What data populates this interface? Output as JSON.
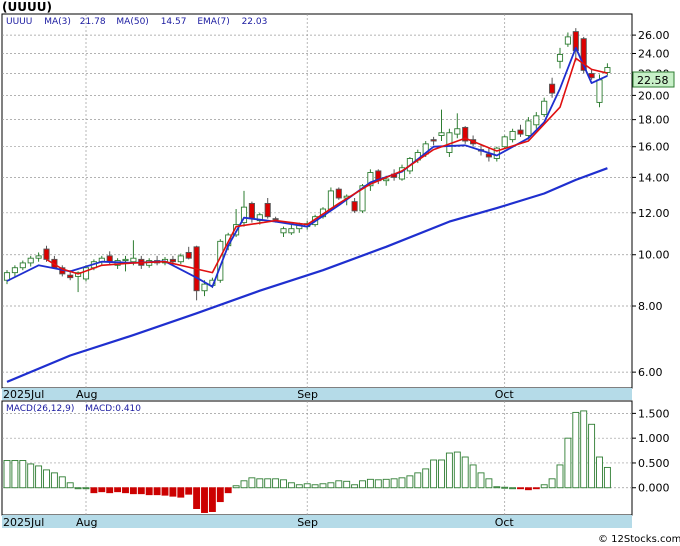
{
  "ticker": "(UUUU)",
  "price_legend": {
    "symbol": "UUUU",
    "ma3_label": "MA(3)",
    "ma3_value": "21.78",
    "ma50_label": "MA(50)",
    "ma50_value": "14.57",
    "ema7_label": "EMA(7)",
    "ema7_value": "22.03"
  },
  "macd_legend": {
    "params_label": "MACD(26,12,9)",
    "value_label": "MACD:0.410"
  },
  "last_price_label": "22.58",
  "watermark": "© 12Stocks.com",
  "colors": {
    "up_candle": "#2e7d32",
    "down_candle": "#dd0000",
    "ma_line": "#1f2fcf",
    "ema_line": "#e01010",
    "macd_positive": "#2e7d32",
    "macd_negative": "#cc0000",
    "date_strip": "#b5dbe8",
    "grid": "#999999",
    "last_price_badge": "#c8f0c8"
  },
  "chart_data": [
    {
      "type": "candlestick",
      "y_scale": "log",
      "ylim": [
        5.6,
        28.5
      ],
      "grid": true,
      "y_ticks": [
        "6.00",
        "8.00",
        "10.00",
        "12.00",
        "14.00",
        "16.00",
        "18.00",
        "20.00",
        "22.00",
        "24.00",
        "26.00"
      ],
      "y_tick_values": [
        6,
        8,
        10,
        12,
        14,
        16,
        18,
        20,
        22,
        24,
        26
      ],
      "x_labels": [
        {
          "label": "2025Jul",
          "index": 0
        },
        {
          "label": "Aug",
          "index": 10
        },
        {
          "label": "Sep",
          "index": 38
        },
        {
          "label": "Oct",
          "index": 63
        }
      ],
      "candles": [
        [
          8.95,
          9.35,
          8.8,
          9.25
        ],
        [
          9.25,
          9.55,
          9.1,
          9.45
        ],
        [
          9.45,
          9.75,
          9.35,
          9.65
        ],
        [
          9.65,
          9.95,
          9.5,
          9.85
        ],
        [
          9.85,
          10.1,
          9.7,
          9.95
        ],
        [
          10.25,
          10.4,
          9.7,
          9.8
        ],
        [
          9.8,
          9.95,
          9.4,
          9.45
        ],
        [
          9.45,
          9.55,
          9.1,
          9.2
        ],
        [
          9.15,
          9.35,
          8.95,
          9.05
        ],
        [
          9.1,
          9.3,
          8.5,
          9.25
        ],
        [
          9.0,
          9.55,
          8.9,
          9.45
        ],
        [
          9.45,
          9.8,
          9.35,
          9.7
        ],
        [
          9.7,
          9.95,
          9.55,
          9.85
        ],
        [
          9.95,
          10.15,
          9.6,
          9.7
        ],
        [
          9.55,
          9.85,
          9.4,
          9.75
        ],
        [
          9.75,
          9.95,
          9.3,
          9.8
        ],
        [
          9.7,
          10.65,
          9.55,
          9.85
        ],
        [
          9.8,
          9.95,
          9.4,
          9.55
        ],
        [
          9.55,
          9.85,
          9.45,
          9.75
        ],
        [
          9.75,
          9.95,
          9.55,
          9.65
        ],
        [
          9.65,
          9.9,
          9.55,
          9.8
        ],
        [
          9.8,
          9.95,
          9.55,
          9.7
        ],
        [
          9.7,
          10.05,
          9.6,
          9.95
        ],
        [
          10.1,
          10.35,
          9.8,
          9.85
        ],
        [
          10.35,
          10.4,
          8.2,
          8.55
        ],
        [
          8.55,
          8.95,
          8.35,
          8.8
        ],
        [
          8.75,
          9.05,
          8.65,
          8.95
        ],
        [
          8.95,
          10.7,
          8.85,
          10.6
        ],
        [
          10.4,
          11.0,
          10.2,
          10.9
        ],
        [
          10.9,
          12.2,
          10.8,
          11.4
        ],
        [
          11.5,
          13.2,
          11.3,
          12.3
        ],
        [
          12.5,
          12.6,
          11.5,
          11.7
        ],
        [
          11.6,
          12.0,
          11.4,
          11.9
        ],
        [
          12.5,
          12.8,
          11.7,
          11.8
        ],
        [
          11.7,
          11.8,
          11.5,
          11.65
        ],
        [
          11.0,
          11.3,
          10.8,
          11.2
        ],
        [
          11.0,
          11.4,
          10.9,
          11.2
        ],
        [
          11.2,
          11.5,
          11.0,
          11.4
        ],
        [
          11.3,
          11.6,
          11.15,
          11.45
        ],
        [
          11.4,
          11.9,
          11.3,
          11.8
        ],
        [
          11.8,
          12.3,
          11.7,
          12.2
        ],
        [
          12.2,
          13.4,
          12.1,
          13.2
        ],
        [
          13.3,
          13.4,
          12.7,
          12.8
        ],
        [
          12.8,
          13.0,
          12.4,
          12.9
        ],
        [
          12.6,
          12.8,
          12.0,
          12.1
        ],
        [
          12.1,
          13.6,
          12.0,
          13.5
        ],
        [
          13.5,
          14.5,
          13.2,
          14.3
        ],
        [
          14.4,
          14.5,
          13.6,
          13.8
        ],
        [
          13.8,
          14.1,
          13.5,
          13.9
        ],
        [
          14.2,
          14.5,
          13.8,
          14.0
        ],
        [
          13.9,
          14.8,
          13.8,
          14.6
        ],
        [
          14.4,
          15.3,
          14.2,
          15.2
        ],
        [
          15.1,
          15.8,
          14.9,
          15.6
        ],
        [
          15.5,
          16.4,
          15.3,
          16.2
        ],
        [
          16.5,
          16.7,
          16.1,
          16.4
        ],
        [
          16.8,
          18.8,
          16.4,
          17.0
        ],
        [
          15.6,
          17.3,
          15.3,
          17.0
        ],
        [
          16.9,
          18.5,
          16.6,
          17.3
        ],
        [
          17.4,
          17.5,
          16.2,
          16.4
        ],
        [
          16.5,
          16.8,
          16.0,
          16.2
        ],
        [
          15.8,
          16.2,
          15.4,
          15.7
        ],
        [
          15.5,
          15.9,
          15.0,
          15.3
        ],
        [
          15.2,
          16.0,
          15.0,
          15.9
        ],
        [
          16.0,
          16.8,
          15.9,
          16.7
        ],
        [
          16.5,
          17.3,
          16.3,
          17.1
        ],
        [
          17.2,
          17.6,
          16.7,
          16.9
        ],
        [
          16.8,
          18.2,
          16.5,
          17.9
        ],
        [
          17.6,
          18.6,
          17.3,
          18.3
        ],
        [
          18.4,
          19.8,
          18.2,
          19.5
        ],
        [
          21.0,
          21.6,
          19.8,
          20.2
        ],
        [
          23.2,
          24.6,
          22.5,
          23.9
        ],
        [
          25.0,
          26.3,
          24.7,
          25.8
        ],
        [
          26.4,
          26.8,
          23.2,
          24.3
        ],
        [
          25.6,
          25.8,
          22.0,
          22.3
        ],
        [
          22.0,
          22.4,
          21.4,
          21.6
        ],
        [
          19.4,
          21.9,
          19.0,
          21.4
        ],
        [
          22.1,
          23.0,
          21.8,
          22.58
        ]
      ],
      "ma50": [
        [
          0,
          5.75
        ],
        [
          8,
          6.45
        ],
        [
          16,
          7.05
        ],
        [
          24,
          7.75
        ],
        [
          32,
          8.55
        ],
        [
          40,
          9.35
        ],
        [
          48,
          10.35
        ],
        [
          56,
          11.55
        ],
        [
          62,
          12.25
        ],
        [
          68,
          13.05
        ],
        [
          72,
          13.85
        ],
        [
          76,
          14.57
        ]
      ],
      "ma3": [
        [
          0,
          8.92
        ],
        [
          4,
          9.55
        ],
        [
          8,
          9.3
        ],
        [
          12,
          9.7
        ],
        [
          16,
          9.65
        ],
        [
          20,
          9.72
        ],
        [
          24,
          9.05
        ],
        [
          26,
          8.7
        ],
        [
          28,
          10.4
        ],
        [
          30,
          11.75
        ],
        [
          34,
          11.55
        ],
        [
          38,
          11.3
        ],
        [
          42,
          12.4
        ],
        [
          46,
          13.7
        ],
        [
          50,
          14.35
        ],
        [
          54,
          16.0
        ],
        [
          58,
          16.1
        ],
        [
          62,
          15.4
        ],
        [
          66,
          16.6
        ],
        [
          68,
          17.8
        ],
        [
          70,
          20.6
        ],
        [
          72,
          24.6
        ],
        [
          74,
          21.1
        ],
        [
          76,
          21.78
        ]
      ],
      "ema7": [
        [
          5,
          9.8
        ],
        [
          7,
          9.4
        ],
        [
          9,
          9.2
        ],
        [
          12,
          9.55
        ],
        [
          16,
          9.65
        ],
        [
          20,
          9.7
        ],
        [
          24,
          9.4
        ],
        [
          26,
          9.25
        ],
        [
          29,
          11.3
        ],
        [
          34,
          11.6
        ],
        [
          38,
          11.4
        ],
        [
          42,
          12.5
        ],
        [
          46,
          13.6
        ],
        [
          50,
          14.4
        ],
        [
          54,
          15.8
        ],
        [
          58,
          16.6
        ],
        [
          62,
          15.7
        ],
        [
          66,
          16.4
        ],
        [
          70,
          19.0
        ],
        [
          72,
          23.5
        ],
        [
          74,
          22.4
        ],
        [
          76,
          22.03
        ]
      ]
    },
    {
      "type": "bar",
      "title": "MACD(26,12,9)",
      "ylim": [
        -0.55,
        1.75
      ],
      "grid": true,
      "y_ticks": [
        "0.000",
        "0.500",
        "1.000",
        "1.500"
      ],
      "y_tick_values": [
        0,
        0.5,
        1.0,
        1.5
      ],
      "x_labels": [
        {
          "label": "2025Jul",
          "index": 0
        },
        {
          "label": "Aug",
          "index": 10
        },
        {
          "label": "Sep",
          "index": 38
        },
        {
          "label": "Oct",
          "index": 63
        }
      ],
      "values": [
        0.55,
        0.55,
        0.55,
        0.48,
        0.44,
        0.36,
        0.3,
        0.22,
        0.1,
        0.0,
        0.0,
        -0.1,
        -0.08,
        -0.1,
        -0.08,
        -0.1,
        -0.12,
        -0.12,
        -0.14,
        -0.14,
        -0.15,
        -0.17,
        -0.19,
        -0.13,
        -0.42,
        -0.5,
        -0.48,
        -0.28,
        -0.1,
        0.04,
        0.14,
        0.2,
        0.18,
        0.18,
        0.18,
        0.16,
        0.1,
        0.06,
        0.08,
        0.06,
        0.08,
        0.1,
        0.14,
        0.13,
        0.06,
        0.14,
        0.17,
        0.16,
        0.17,
        0.18,
        0.2,
        0.24,
        0.3,
        0.38,
        0.56,
        0.56,
        0.7,
        0.72,
        0.62,
        0.46,
        0.3,
        0.18,
        0.02,
        0.01,
        0.0,
        -0.02,
        -0.04,
        -0.02,
        0.06,
        0.18,
        0.46,
        1.0,
        1.52,
        1.55,
        1.28,
        0.62,
        0.41
      ]
    }
  ]
}
